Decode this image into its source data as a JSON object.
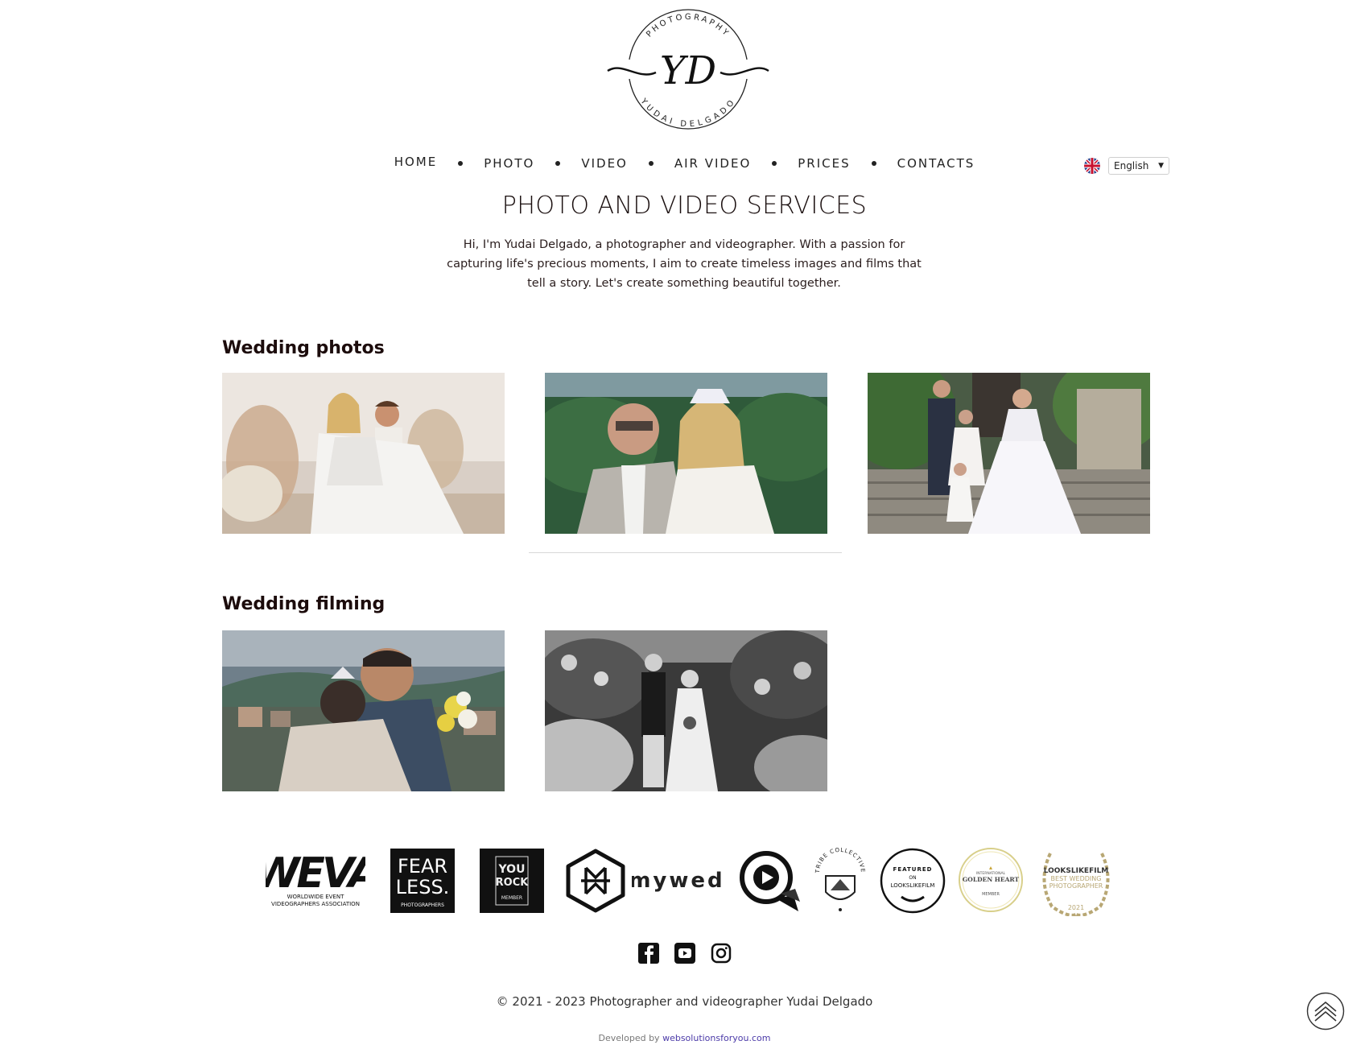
{
  "logo": {
    "top_text": "PHOTOGRAPHY",
    "monogram": "YD",
    "bottom_text": "YUDAI DELGADO"
  },
  "nav": {
    "items": [
      "HOME",
      "PHOTO",
      "VIDEO",
      "AIR VIDEO",
      "PRICES",
      "CONTACTS"
    ]
  },
  "language": {
    "flag_icon": "uk-flag-icon",
    "selected": "English"
  },
  "hero": {
    "title": "PHOTO AND VIDEO SERVICES",
    "description": "Hi, I'm Yudai Delgado, a photographer and videographer. With a passion for capturing life's precious moments, I aim to create timeless images and films that tell a story. Let's create something beautiful together."
  },
  "sections": {
    "wedding_photos": {
      "title": "Wedding photos"
    },
    "wedding_filming": {
      "title": "Wedding filming"
    }
  },
  "badges": {
    "weva": {
      "main": "WEVA",
      "sub1": "WORLDWIDE EVENT",
      "sub2": "VIDEOGRAPHERS ASSOCIATION"
    },
    "fearless": {
      "line1": "FEAR",
      "line2": "LESS.",
      "sub": "PHOTOGRAPHERS"
    },
    "yourock": {
      "line1": "YOU",
      "line2": "ROCK",
      "sub": "MEMBER"
    },
    "mywed": {
      "text": "mywed"
    },
    "tribe": {
      "text": "TRIBE COLLECTIVE"
    },
    "featured": {
      "line1": "FEATURED",
      "line2": "ON",
      "line3": "LOOKSLIKEFILM"
    },
    "golden_heart": {
      "line1": "INTERNATIONAL",
      "line2": "GOLDEN HEART",
      "line3": "MEMBER"
    },
    "lookslikefilm": {
      "line1": "LOOKSLIKEFILM",
      "line2": "BEST WEDDING",
      "line3": "PHOTOGRAPHER",
      "year": "2021"
    }
  },
  "social": [
    "facebook-icon",
    "youtube-icon",
    "instagram-icon"
  ],
  "footer": {
    "copyright": "© 2021 - 2023 Photographer and videographer Yudai Delgado",
    "developed_prefix": "Developed by",
    "developed_link": "websolutionsforyou.com"
  },
  "colors": {
    "text_dark": "#1a0f0f",
    "link": "#4b3aa8",
    "gold": "#b8a774"
  }
}
